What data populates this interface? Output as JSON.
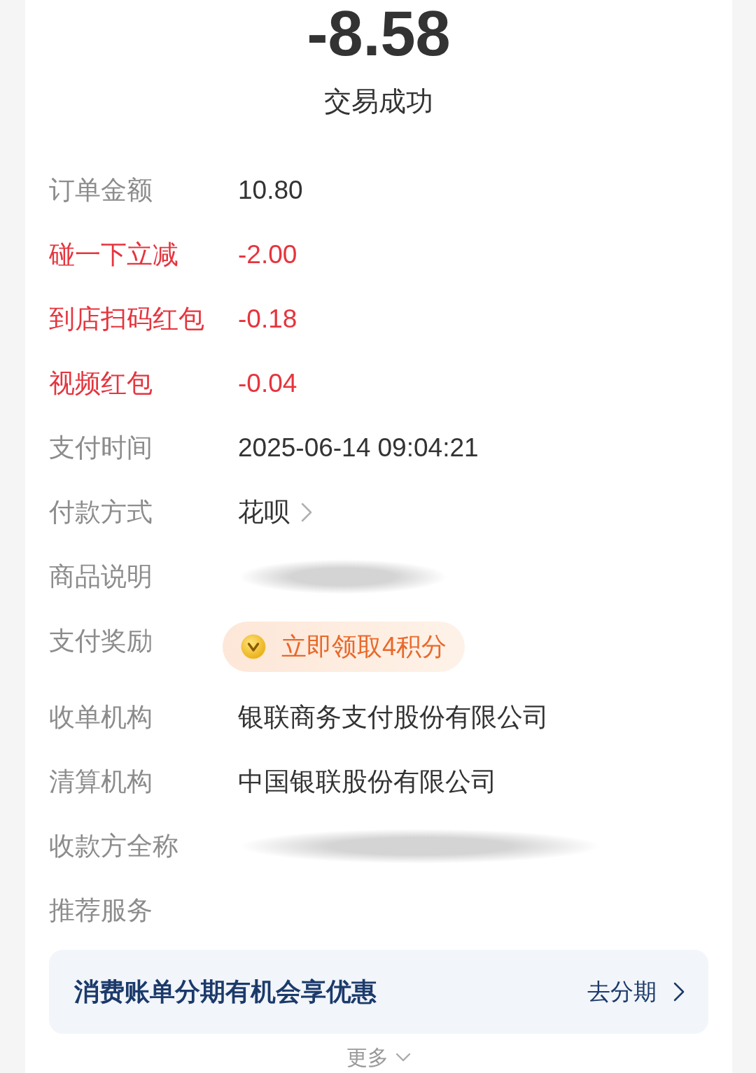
{
  "amount": "-8.58",
  "status": "交易成功",
  "details": [
    {
      "label": "订单金额",
      "kind": "text",
      "value": "10.80",
      "discount": false
    },
    {
      "label": "碰一下立减",
      "kind": "text",
      "value": "-2.00",
      "discount": true
    },
    {
      "label": "到店扫码红包",
      "kind": "text",
      "value": "-0.18",
      "discount": true
    },
    {
      "label": "视频红包",
      "kind": "text",
      "value": "-0.04",
      "discount": true
    },
    {
      "label": "支付时间",
      "kind": "text",
      "value": "2025-06-14 09:04:21",
      "discount": false
    },
    {
      "label": "付款方式",
      "kind": "link",
      "value": "花呗",
      "discount": false
    },
    {
      "label": "商品说明",
      "kind": "redacted",
      "discount": false
    },
    {
      "label": "支付奖励",
      "kind": "reward",
      "value": "立即领取4积分",
      "discount": false
    },
    {
      "label": "收单机构",
      "kind": "text",
      "value": "银联商务支付股份有限公司",
      "discount": false
    },
    {
      "label": "清算机构",
      "kind": "text",
      "value": "中国银联股份有限公司",
      "discount": false
    },
    {
      "label": "收款方全称",
      "kind": "redacted",
      "discount": false
    }
  ],
  "recommend": {
    "title": "推荐服务",
    "banner_text": "消费账单分期有机会享优惠",
    "action": "去分期"
  },
  "more": "更多"
}
